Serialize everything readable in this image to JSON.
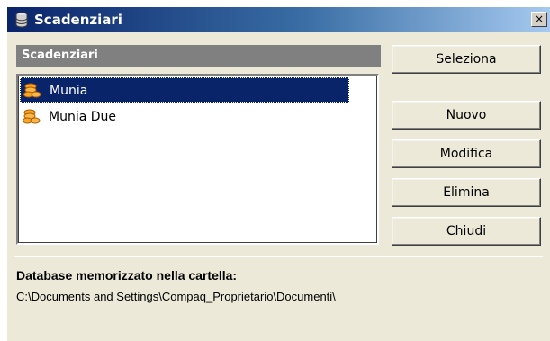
{
  "window": {
    "title": "Scadenziari",
    "close_glyph": "×",
    "title_icon": "database-icon"
  },
  "list": {
    "header": "Scadenziari",
    "items": [
      {
        "label": "Munia",
        "icon": "coins-icon",
        "selected": true
      },
      {
        "label": "Munia Due",
        "icon": "coins-icon",
        "selected": false
      }
    ]
  },
  "buttons": {
    "seleziona": "Seleziona",
    "nuovo": "Nuovo",
    "modifica": "Modifica",
    "elimina": "Elimina",
    "chiudi": "Chiudi"
  },
  "footer": {
    "label": "Database memorizzato nella cartella:",
    "path": "C:\\Documents and Settings\\Compaq_Proprietario\\Documenti\\"
  },
  "colors": {
    "title_start": "#0a246a",
    "title_end": "#a6caf0",
    "selection": "#0a246a",
    "face": "#ece9d8",
    "header": "#808080"
  }
}
